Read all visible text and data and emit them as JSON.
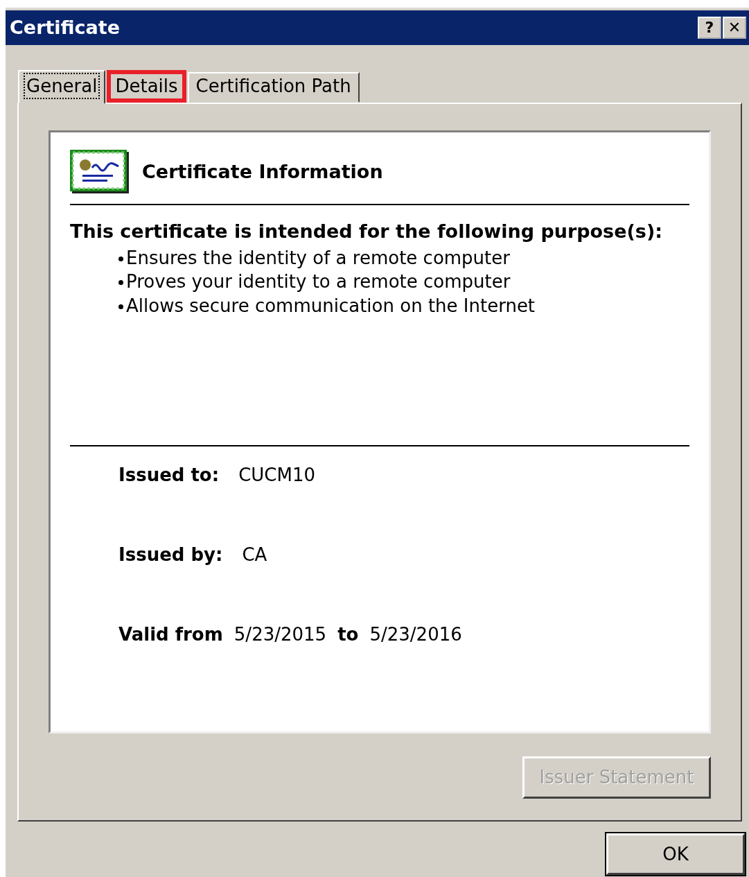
{
  "window": {
    "title": "Certificate",
    "title_buttons": [
      "?",
      "✕"
    ]
  },
  "tabs": [
    {
      "label": "General",
      "selected": true,
      "highlighted": false
    },
    {
      "label": "Details",
      "selected": false,
      "highlighted": true
    },
    {
      "label": "Certification Path",
      "selected": false,
      "highlighted": false
    }
  ],
  "info": {
    "heading": "Certificate Information",
    "purpose_heading": "This certificate is intended for the following purpose(s):",
    "purposes": [
      "Ensures the identity of a remote computer",
      "Proves your identity to a remote computer",
      "Allows secure communication on the Internet"
    ],
    "issued_to": {
      "label": "Issued to:",
      "value": "CUCM10"
    },
    "issued_by": {
      "label": "Issued by:",
      "value": "CA"
    },
    "validity": {
      "label": "Valid from",
      "from": "5/23/2015",
      "separator": "to",
      "to": "5/23/2016"
    }
  },
  "buttons": [
    {
      "label": "Issuer Statement",
      "disabled": true,
      "kind": "panel"
    },
    {
      "label": "OK",
      "disabled": false,
      "kind": "dialog"
    }
  ]
}
